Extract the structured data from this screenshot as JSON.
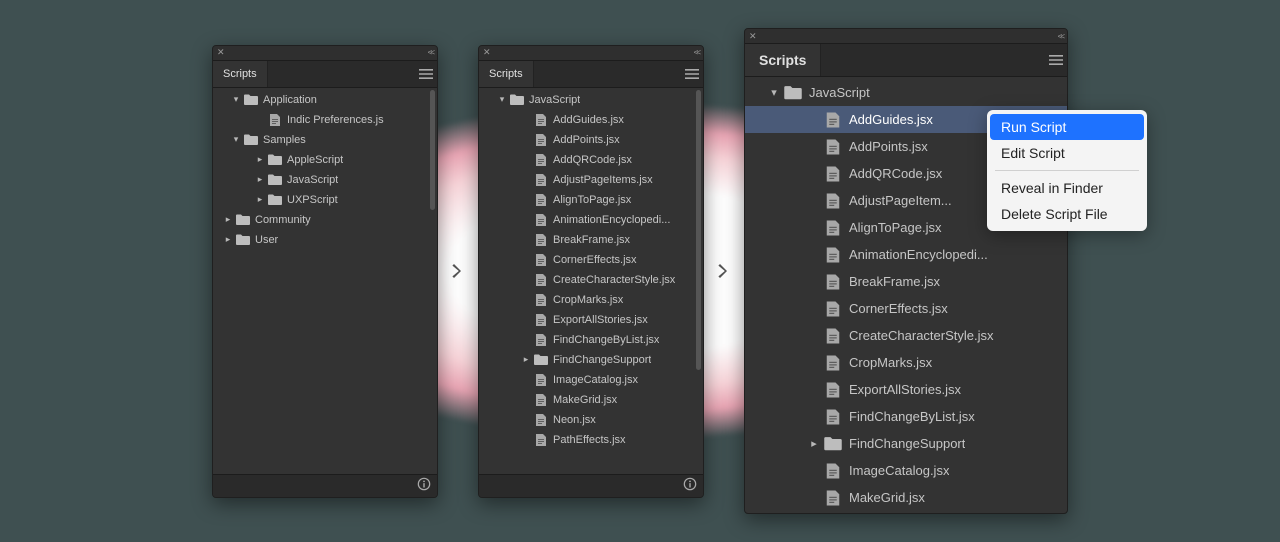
{
  "panel_title": "Scripts",
  "panel1": {
    "scroll_thumb_height": 120,
    "tree": [
      {
        "depth": 0,
        "tw": "down",
        "icon": "folder",
        "label": "Application"
      },
      {
        "depth": 1,
        "tw": "",
        "icon": "script",
        "label": "Indic Preferences.js"
      },
      {
        "depth": 0,
        "tw": "down",
        "icon": "folder",
        "label": "Samples"
      },
      {
        "depth": 1,
        "tw": "right",
        "icon": "folder",
        "label": "AppleScript"
      },
      {
        "depth": 1,
        "tw": "right",
        "icon": "folder",
        "label": "JavaScript"
      },
      {
        "depth": 1,
        "tw": "right",
        "icon": "folder",
        "label": "UXPScript"
      },
      {
        "depth": -1,
        "tw": "right",
        "icon": "folder",
        "label": "Community"
      },
      {
        "depth": -1,
        "tw": "right",
        "icon": "folder",
        "label": "User"
      }
    ]
  },
  "panel2": {
    "scroll_thumb_height": 280,
    "tree": [
      {
        "depth": 0,
        "tw": "down",
        "icon": "folder",
        "label": "JavaScript"
      },
      {
        "depth": 1,
        "tw": "",
        "icon": "script",
        "label": "AddGuides.jsx"
      },
      {
        "depth": 1,
        "tw": "",
        "icon": "script",
        "label": "AddPoints.jsx"
      },
      {
        "depth": 1,
        "tw": "",
        "icon": "script",
        "label": "AddQRCode.jsx"
      },
      {
        "depth": 1,
        "tw": "",
        "icon": "script",
        "label": "AdjustPageItems.jsx"
      },
      {
        "depth": 1,
        "tw": "",
        "icon": "script",
        "label": "AlignToPage.jsx"
      },
      {
        "depth": 1,
        "tw": "",
        "icon": "script",
        "label": "AnimationEncyclopedi..."
      },
      {
        "depth": 1,
        "tw": "",
        "icon": "script",
        "label": "BreakFrame.jsx"
      },
      {
        "depth": 1,
        "tw": "",
        "icon": "script",
        "label": "CornerEffects.jsx"
      },
      {
        "depth": 1,
        "tw": "",
        "icon": "script",
        "label": "CreateCharacterStyle.jsx"
      },
      {
        "depth": 1,
        "tw": "",
        "icon": "script",
        "label": "CropMarks.jsx"
      },
      {
        "depth": 1,
        "tw": "",
        "icon": "script",
        "label": "ExportAllStories.jsx"
      },
      {
        "depth": 1,
        "tw": "",
        "icon": "script",
        "label": "FindChangeByList.jsx"
      },
      {
        "depth": 1,
        "tw": "right",
        "icon": "folder",
        "label": "FindChangeSupport"
      },
      {
        "depth": 1,
        "tw": "",
        "icon": "script",
        "label": "ImageCatalog.jsx"
      },
      {
        "depth": 1,
        "tw": "",
        "icon": "script",
        "label": "MakeGrid.jsx"
      },
      {
        "depth": 1,
        "tw": "",
        "icon": "script",
        "label": "Neon.jsx"
      },
      {
        "depth": 1,
        "tw": "",
        "icon": "script",
        "label": "PathEffects.jsx"
      }
    ]
  },
  "panel3": {
    "tree": [
      {
        "depth": 0,
        "tw": "down",
        "icon": "folder",
        "label": "JavaScript"
      },
      {
        "depth": 1,
        "tw": "",
        "icon": "script",
        "label": "AddGuides.jsx",
        "selected": true
      },
      {
        "depth": 1,
        "tw": "",
        "icon": "script",
        "label": "AddPoints.jsx"
      },
      {
        "depth": 1,
        "tw": "",
        "icon": "script",
        "label": "AddQRCode.jsx"
      },
      {
        "depth": 1,
        "tw": "",
        "icon": "script",
        "label": "AdjustPageItem..."
      },
      {
        "depth": 1,
        "tw": "",
        "icon": "script",
        "label": "AlignToPage.jsx"
      },
      {
        "depth": 1,
        "tw": "",
        "icon": "script",
        "label": "AnimationEncyclopedi..."
      },
      {
        "depth": 1,
        "tw": "",
        "icon": "script",
        "label": "BreakFrame.jsx"
      },
      {
        "depth": 1,
        "tw": "",
        "icon": "script",
        "label": "CornerEffects.jsx"
      },
      {
        "depth": 1,
        "tw": "",
        "icon": "script",
        "label": "CreateCharacterStyle.jsx"
      },
      {
        "depth": 1,
        "tw": "",
        "icon": "script",
        "label": "CropMarks.jsx"
      },
      {
        "depth": 1,
        "tw": "",
        "icon": "script",
        "label": "ExportAllStories.jsx"
      },
      {
        "depth": 1,
        "tw": "",
        "icon": "script",
        "label": "FindChangeByList.jsx"
      },
      {
        "depth": 1,
        "tw": "right",
        "icon": "folder",
        "label": "FindChangeSupport"
      },
      {
        "depth": 1,
        "tw": "",
        "icon": "script",
        "label": "ImageCatalog.jsx"
      },
      {
        "depth": 1,
        "tw": "",
        "icon": "script",
        "label": "MakeGrid.jsx"
      }
    ]
  },
  "context_menu": {
    "items": [
      {
        "label": "Run Script",
        "highlight": true
      },
      {
        "label": "Edit Script"
      },
      {
        "sep": true
      },
      {
        "label": "Reveal in Finder"
      },
      {
        "label": "Delete Script File"
      }
    ]
  },
  "indent_small_base": 16,
  "indent_small_step": 24,
  "indent_big_base": 20,
  "indent_big_step": 40
}
